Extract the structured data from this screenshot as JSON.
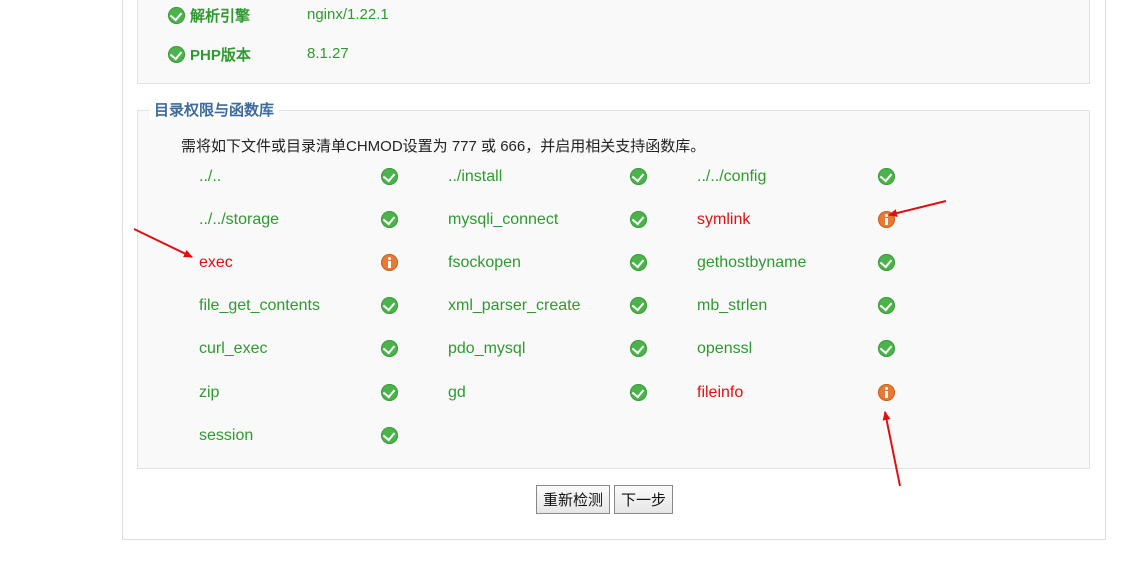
{
  "environment": {
    "items": [
      {
        "label": "解析引擎",
        "value": "nginx/1.22.1",
        "status": "ok"
      },
      {
        "label": "PHP版本",
        "value": "8.1.27",
        "status": "ok"
      }
    ]
  },
  "permissions": {
    "legend": "目录权限与函数库",
    "note": "需将如下文件或目录清单CHMOD设置为 777 或 666，并启用相关支持函数库。",
    "items": [
      {
        "name": "../..",
        "status": "ok"
      },
      {
        "name": "../install",
        "status": "ok"
      },
      {
        "name": "../../config",
        "status": "ok"
      },
      {
        "name": "../../storage",
        "status": "ok"
      },
      {
        "name": "mysqli_connect",
        "status": "ok"
      },
      {
        "name": "symlink",
        "status": "fail"
      },
      {
        "name": "exec",
        "status": "fail"
      },
      {
        "name": "fsockopen",
        "status": "ok"
      },
      {
        "name": "gethostbyname",
        "status": "ok"
      },
      {
        "name": "file_get_contents",
        "status": "ok"
      },
      {
        "name": "xml_parser_create",
        "status": "ok"
      },
      {
        "name": "mb_strlen",
        "status": "ok"
      },
      {
        "name": "curl_exec",
        "status": "ok"
      },
      {
        "name": "pdo_mysql",
        "status": "ok"
      },
      {
        "name": "openssl",
        "status": "ok"
      },
      {
        "name": "zip",
        "status": "ok"
      },
      {
        "name": "gd",
        "status": "ok"
      },
      {
        "name": "fileinfo",
        "status": "fail"
      },
      {
        "name": "session",
        "status": "ok"
      }
    ]
  },
  "buttons": {
    "recheck": "重新检测",
    "next": "下一步"
  },
  "colors": {
    "ok": "#2e9a2e",
    "fail": "#e01010",
    "legend": "#3c6b9c",
    "annotation_arrow": "#e01010"
  }
}
